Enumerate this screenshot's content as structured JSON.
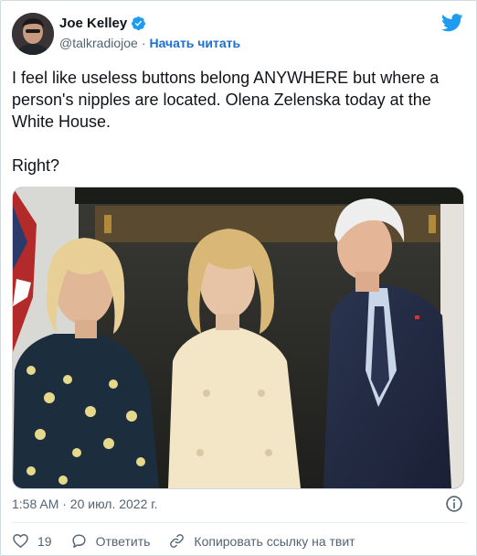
{
  "author": {
    "name": "Joe Kelley",
    "handle": "@talkradiojoe",
    "separator": "·",
    "follow_label": "Начать читать"
  },
  "tweet": {
    "text": "I feel like useless buttons belong ANYWHERE but where a person's nipples are located. Olena Zelenska today at the White House.\n\nRight?",
    "timestamp": "1:58 AM · 20 июл. 2022 г."
  },
  "actions": {
    "like_count": "19",
    "reply_label": "Ответить",
    "copy_link_label": "Копировать ссылку на твит"
  },
  "colors": {
    "twitter_blue": "#1d9bf0",
    "text_primary": "#0f1419",
    "text_secondary": "#536471"
  },
  "icons": [
    "verified-badge-icon",
    "twitter-bird-icon",
    "info-icon",
    "heart-icon",
    "reply-icon",
    "link-icon"
  ]
}
